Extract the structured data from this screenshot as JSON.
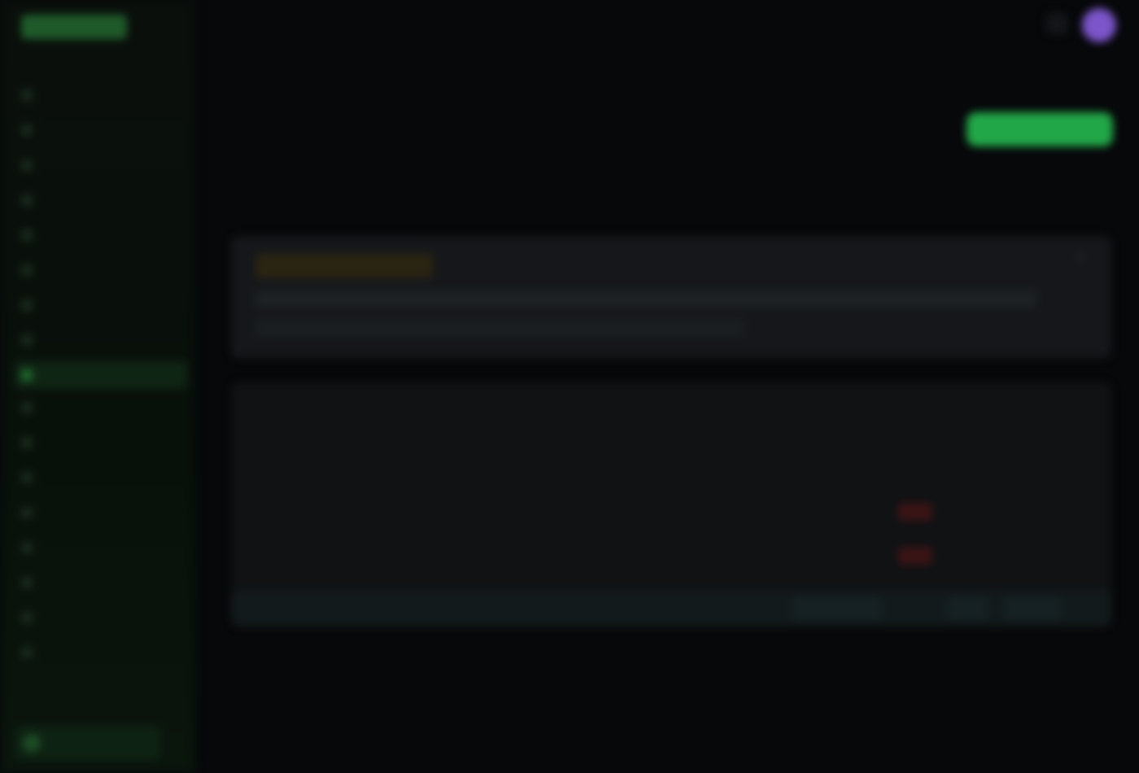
{
  "app": {
    "logo_text": ""
  },
  "sidebar": {
    "items": [
      {
        "label": "",
        "active": false
      },
      {
        "label": "",
        "active": false
      },
      {
        "label": "",
        "active": false
      },
      {
        "label": "",
        "active": false
      },
      {
        "label": "",
        "active": false
      },
      {
        "label": "",
        "active": false
      },
      {
        "label": "",
        "active": false
      },
      {
        "label": "",
        "active": false
      },
      {
        "label": "",
        "active": true
      },
      {
        "label": "",
        "active": false
      },
      {
        "label": "",
        "active": false
      },
      {
        "label": "",
        "active": false
      },
      {
        "label": "",
        "active": false
      },
      {
        "label": "",
        "active": false
      },
      {
        "label": "",
        "active": false
      },
      {
        "label": "",
        "active": false
      },
      {
        "label": "",
        "active": false
      },
      {
        "label": "",
        "active": false
      }
    ],
    "footer_label": ""
  },
  "topbar": {
    "avatar_initial": ""
  },
  "header": {
    "title": "",
    "subtitle": "",
    "subtitle_extra": "",
    "primary_button": ""
  },
  "tabs": [
    "",
    "",
    "",
    ""
  ],
  "notice": {
    "title": "",
    "line1": "",
    "line2": ""
  },
  "table": {
    "title": "",
    "columns": [
      "",
      "",
      "",
      ""
    ],
    "rows": [
      [
        "",
        "",
        "",
        "",
        ""
      ],
      [
        "",
        "",
        "",
        "",
        ""
      ],
      [
        "",
        "",
        "",
        "",
        ""
      ]
    ],
    "footer_text": "",
    "footer_buttons": [
      "",
      "",
      ""
    ]
  },
  "colors": {
    "accent": "#22a748",
    "warning": "#b59a3a",
    "danger": "#a33a3c",
    "avatar": "#7b55c9"
  }
}
